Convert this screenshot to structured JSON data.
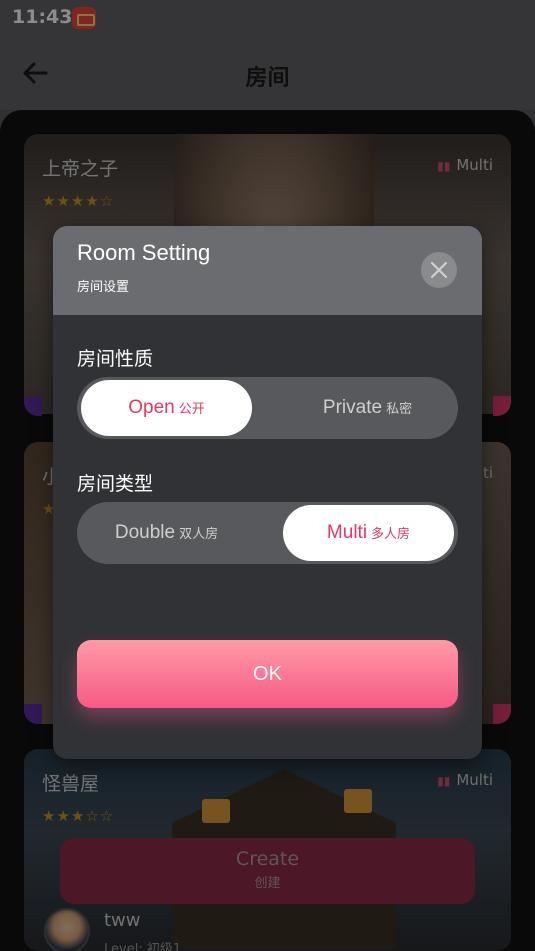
{
  "status_bar": {
    "time": "11:43"
  },
  "header": {
    "title": "房间"
  },
  "rooms": [
    {
      "name": "上帝之子",
      "stars": "★★★★☆",
      "mode": "Multi"
    },
    {
      "name": "小",
      "stars": "★",
      "mode": "Multi"
    },
    {
      "name": "怪兽屋",
      "stars": "★★★☆☆",
      "mode": "Multi"
    }
  ],
  "create_button": {
    "label_en": "Create",
    "label_cn": "创建"
  },
  "user": {
    "name": "tww",
    "level": "Level: 初级1"
  },
  "modal": {
    "title": "Room Setting",
    "subtitle": "房间设置",
    "room_nature": {
      "label": "房间性质",
      "options": [
        {
          "en": "Open",
          "cn": "公开",
          "selected": true
        },
        {
          "en": "Private",
          "cn": "私密",
          "selected": false
        }
      ]
    },
    "room_type": {
      "label": "房间类型",
      "options": [
        {
          "en": "Double",
          "cn": "双人房",
          "selected": false
        },
        {
          "en": "Multi",
          "cn": "多人房",
          "selected": true
        }
      ]
    },
    "ok_label": "OK"
  },
  "colors": {
    "accent": "#e8385f",
    "ok_gradient_top": "#ff9aa6",
    "ok_gradient_bottom": "#f75a86"
  }
}
